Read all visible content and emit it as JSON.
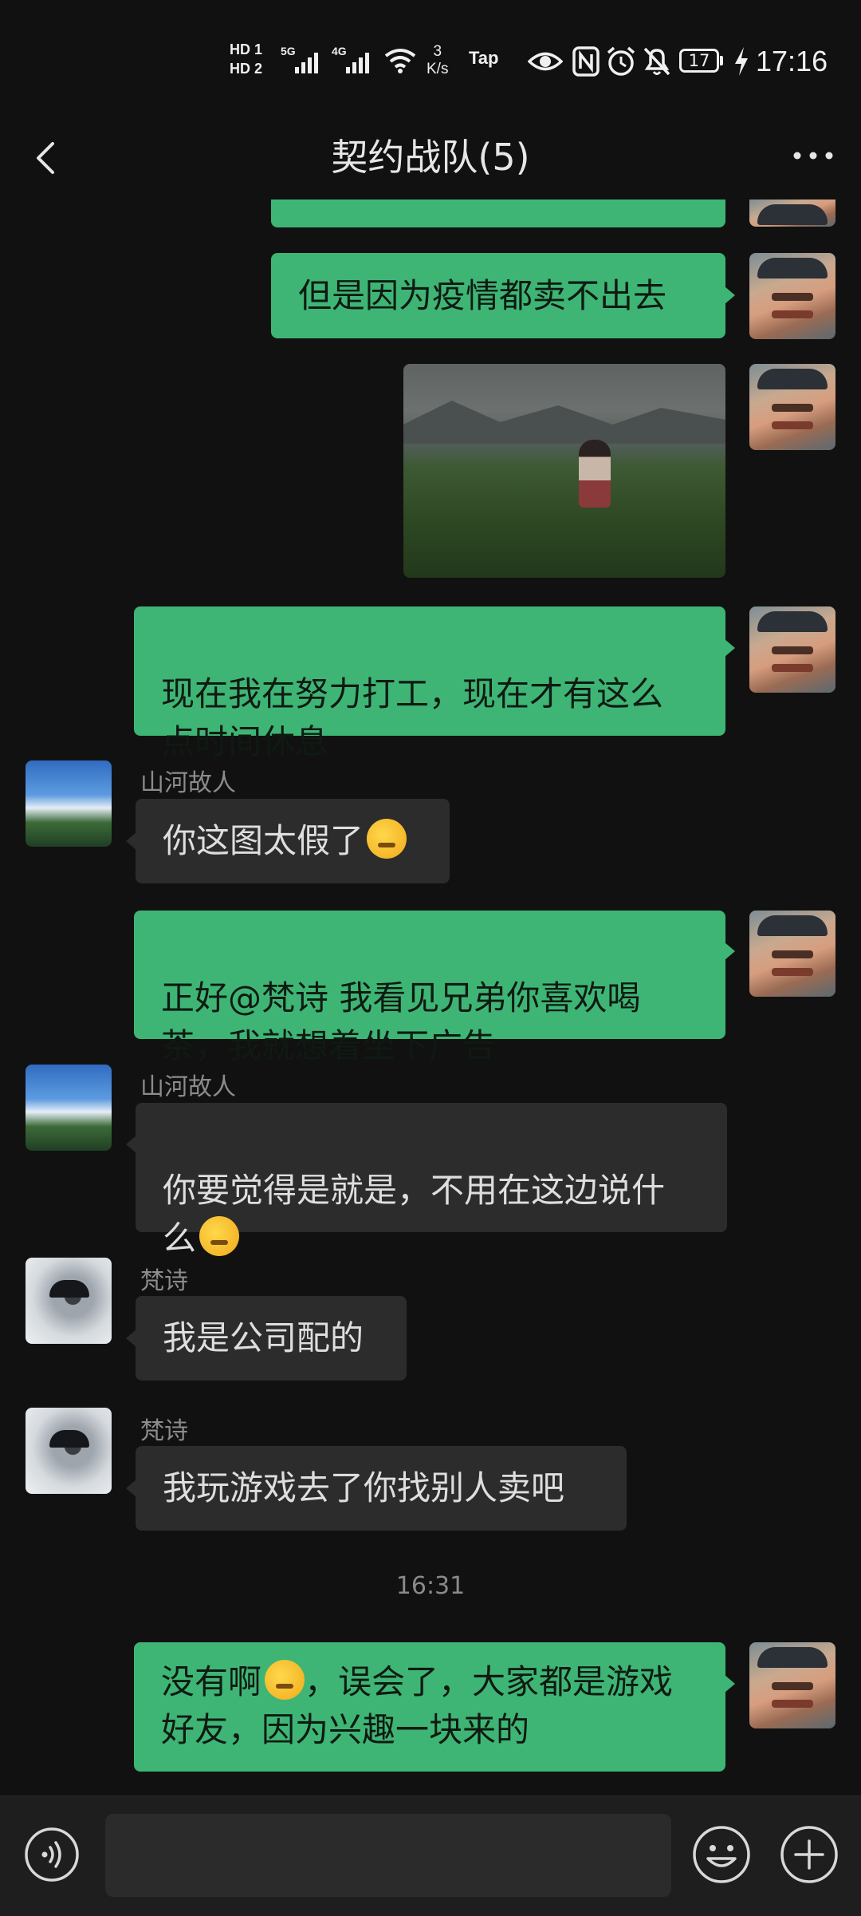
{
  "status_bar": {
    "hd1": "HD 1",
    "hd2": "HD 2",
    "net1": "5G",
    "net2": "4G",
    "speed_value": "3",
    "speed_unit": "K/s",
    "tap": "Tap",
    "battery": "17",
    "time": "17:16",
    "icons": [
      "eye-icon",
      "nfc-icon",
      "alarm-icon",
      "mute-icon",
      "charging-icon",
      "wifi-icon"
    ]
  },
  "header": {
    "title": "契约战队(5)",
    "back_icon": "back-arrow-icon",
    "more_icon": "more-icon"
  },
  "messages": [
    {
      "from": "me",
      "text": "但是因为疫情都卖不出去"
    },
    {
      "from": "me",
      "type": "image",
      "alt": "tea-field-photo"
    },
    {
      "from": "me",
      "text": "现在我在努力打工，现在才有这么\n点时间休息"
    },
    {
      "from": "山河故人",
      "sender": "山河故人",
      "text": "你这图太假了",
      "emoji": "thinking-emoji"
    },
    {
      "from": "me",
      "text": "正好@梵诗  我看见兄弟你喜欢喝\n茶，我就想着坐下广告"
    },
    {
      "from": "山河故人",
      "sender": "山河故人",
      "text": "你要觉得是就是，不用在这边说什\n么",
      "emoji": "thinking-emoji"
    },
    {
      "from": "梵诗",
      "sender": "梵诗",
      "text": "我是公司配的"
    },
    {
      "from": "梵诗",
      "sender": "梵诗",
      "text": "我玩游戏去了你找别人卖吧"
    }
  ],
  "timestamp": "16:31",
  "last_message": {
    "from": "me",
    "part1": "没有啊",
    "emoji": "laughing-emoji",
    "part2": "，误会了，大家都是游戏",
    "line2": "好友，因为兴趣一块来的"
  },
  "input_bar": {
    "voice_icon": "voice-icon",
    "emoji_icon": "emoji-icon",
    "plus_icon": "plus-icon",
    "value": ""
  },
  "colors": {
    "background": "#111111",
    "my_bubble": "#3eb575",
    "their_bubble": "#2c2c2c",
    "sender_name": "#8c8c8c"
  }
}
